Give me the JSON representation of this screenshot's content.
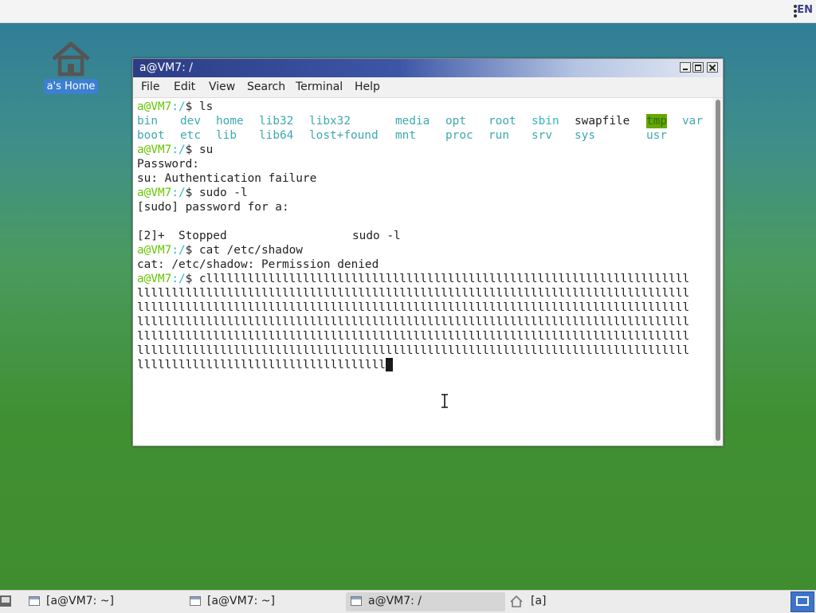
{
  "top_panel": {
    "lang": "EN"
  },
  "desktop": {
    "home_icon_label": "a's Home"
  },
  "window": {
    "title": "a@VM7: /",
    "menu": [
      "File",
      "Edit",
      "View",
      "Search",
      "Terminal",
      "Help"
    ]
  },
  "terminal": {
    "prompt_user": "a@VM7",
    "prompt_path": ":/",
    "prompt_dollar": "$",
    "cmd1": " ls",
    "ls": {
      "row1": [
        "bin",
        "dev",
        "home",
        "lib32",
        "libx32",
        "media",
        "opt",
        "root",
        "sbin",
        "swapfile",
        "tmp",
        "var"
      ],
      "row2": [
        "boot",
        "etc",
        "lib",
        "lib64",
        "lost+found",
        "mnt",
        "proc",
        "run",
        "srv",
        "sys",
        "usr"
      ]
    },
    "cmd2": " su",
    "out_password": "Password:",
    "out_su_fail": "su: Authentication failure",
    "cmd3": " sudo -l",
    "out_sudo_pw": "[sudo] password for a:",
    "out_stopped_job": "[2]+  Stopped",
    "out_stopped_cmd": "sudo -l",
    "cmd4": " cat /etc/shadow",
    "out_perm": "cat: /etc/shadow: Permission denied",
    "cmd5": " cllllllllllllllllllllllllllllllllllllllllllllllllllllllllllllllllllllll",
    "wrap": [
      "llllllllllllllllllllllllllllllllllllllllllllllllllllllllllllllllllllllllllllllll",
      "llllllllllllllllllllllllllllllllllllllllllllllllllllllllllllllllllllllllllllllll",
      "llllllllllllllllllllllllllllllllllllllllllllllllllllllllllllllllllllllllllllllll",
      "llllllllllllllllllllllllllllllllllllllllllllllllllllllllllllllllllllllllllllllll",
      "llllllllllllllllllllllllllllllllllllllllllllllllllllllllllllllllllllllllllllllll",
      "llllllllllllllllllllllllllllllllllll"
    ]
  },
  "taskbar": {
    "tasks": [
      "[a@VM7: ~]",
      "[a@VM7: ~]",
      "a@VM7: /",
      "[a]"
    ]
  },
  "colors": {
    "prompt": "#66c500",
    "dir": "#3fa8b0",
    "highlight_bg": "#65a800"
  }
}
